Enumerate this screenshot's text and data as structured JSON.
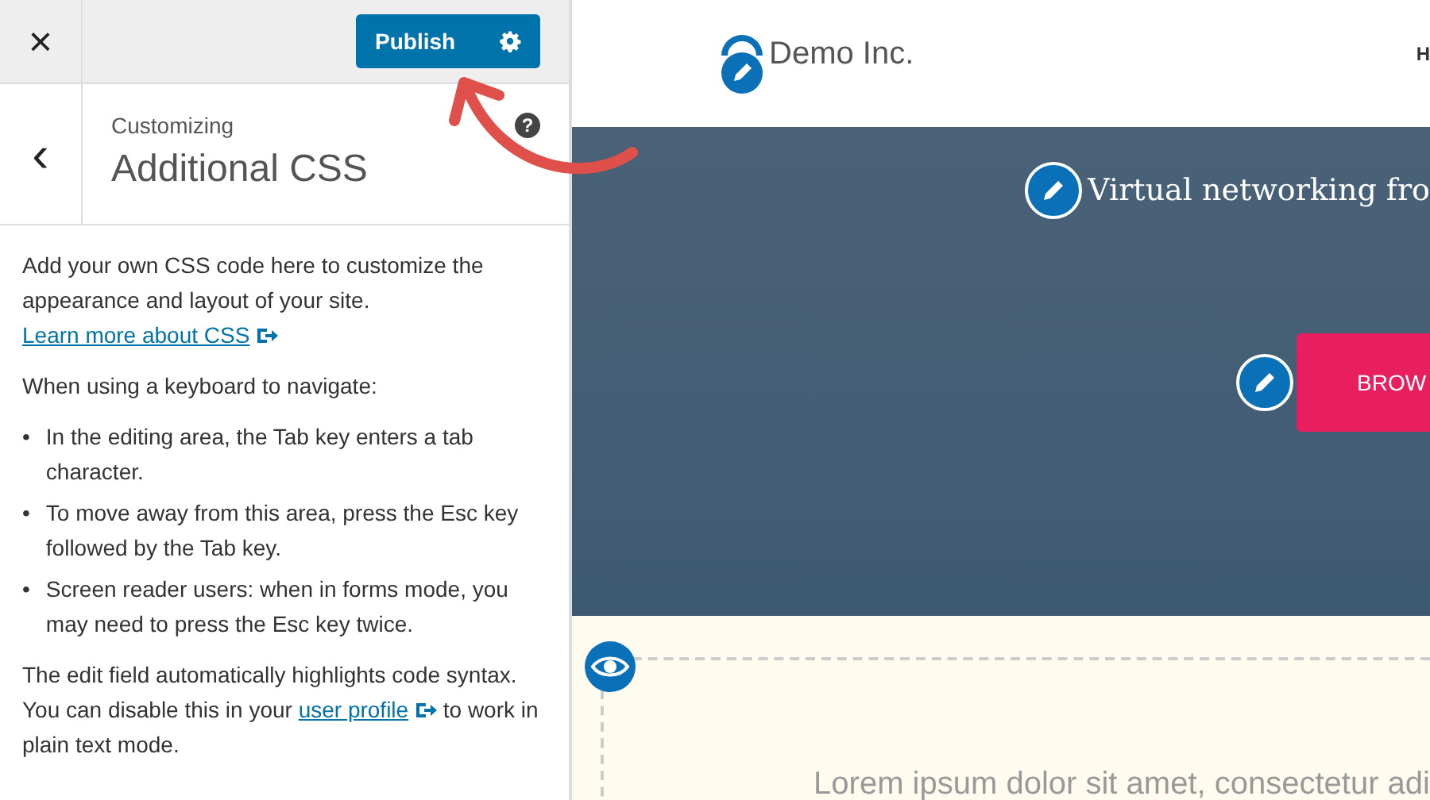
{
  "topbar": {
    "close": "×",
    "publish": "Publish"
  },
  "section": {
    "back": "‹",
    "eyebrow": "Customizing",
    "title": "Additional CSS",
    "help": "?"
  },
  "intro": {
    "text": "Add your own CSS code here to customize the appearance and layout of your site.",
    "link": "Learn more about CSS"
  },
  "keyboard_heading": "When using a keyboard to navigate:",
  "tip_marker": "•",
  "tips": [
    "In the editing area, the Tab key enters a tab character.",
    "To move away from this area, press the Esc key followed by the Tab key.",
    "Screen reader users: when in forms mode, you may need to press the Esc key twice."
  ],
  "edit_note": {
    "before": "The edit field automatically highlights code syntax. You can disable this in your",
    "link": "user profile",
    "after": "to work in plain text mode."
  },
  "preview": {
    "site_name": "Demo Inc.",
    "nav_item": "H",
    "hero_heading": "Virtual networking fro",
    "hero_button": "BROW",
    "body_text": "Lorem ipsum dolor sit amet, consectetur adi"
  }
}
